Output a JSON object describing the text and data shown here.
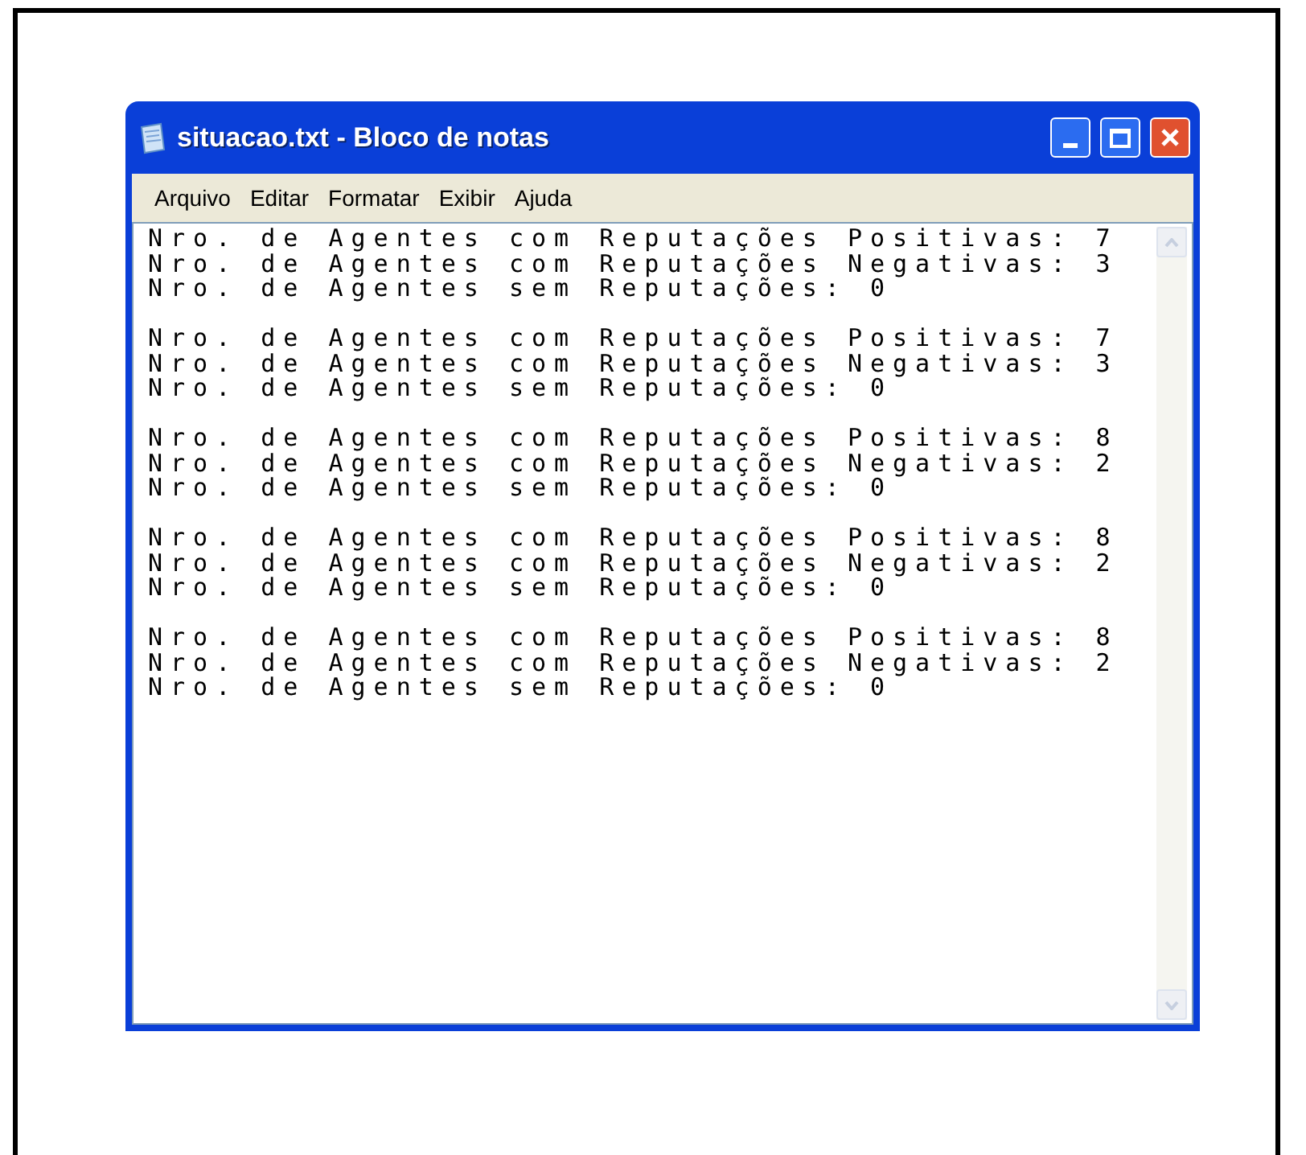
{
  "window": {
    "title": "situacao.txt - Bloco de notas"
  },
  "menu": [
    "Arquivo",
    "Editar",
    "Formatar",
    "Exibir",
    "Ajuda"
  ],
  "blocks": [
    {
      "lines": [
        "Nro. de Agentes com Reputações Positivas: 7",
        "Nro. de Agentes com Reputações Negativas: 3",
        "Nro. de Agentes sem Reputações: 0"
      ]
    },
    {
      "lines": [
        "Nro. de Agentes com Reputações Positivas: 7",
        "Nro. de Agentes com Reputações Negativas: 3",
        "Nro. de Agentes sem Reputações: 0"
      ]
    },
    {
      "lines": [
        "Nro. de Agentes com Reputações Positivas: 8",
        "Nro. de Agentes com Reputações Negativas: 2",
        "Nro. de Agentes sem Reputações: 0"
      ]
    },
    {
      "lines": [
        "Nro. de Agentes com Reputações Positivas: 8",
        "Nro. de Agentes com Reputações Negativas: 2",
        "Nro. de Agentes sem Reputações: 0"
      ]
    },
    {
      "lines": [
        "Nro. de Agentes com Reputações Positivas: 8",
        "Nro. de Agentes com Reputações Negativas: 2",
        "Nro. de Agentes sem Reputações: 0"
      ]
    }
  ]
}
